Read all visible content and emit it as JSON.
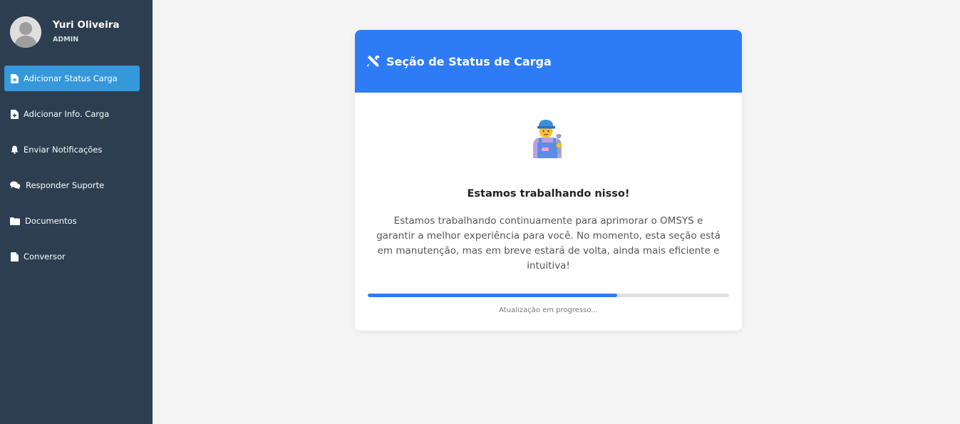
{
  "sidebar": {
    "user": {
      "name": "Yuri Oliveira",
      "role": "ADMIN"
    },
    "items": [
      {
        "label": "Adicionar Status Carga",
        "icon": "file-plus-icon",
        "active": true
      },
      {
        "label": "Adicionar Info. Carga",
        "icon": "file-plus-icon",
        "active": false
      },
      {
        "label": "Enviar Notificações",
        "icon": "bell-icon",
        "active": false
      },
      {
        "label": "Responder Suporte",
        "icon": "comments-icon",
        "active": false
      },
      {
        "label": "Documentos",
        "icon": "folder-icon",
        "active": false
      },
      {
        "label": "Conversor",
        "icon": "file-icon",
        "active": false
      }
    ]
  },
  "card": {
    "title": "Seção de Status de Carga",
    "title_icon": "tools-icon",
    "illustration": "mechanic-emoji",
    "subtitle": "Estamos trabalhando nisso!",
    "description": "Estamos trabalhando continuamente para aprimorar o OMSYS e garantir a melhor experiência para você. No momento, esta seção está em manutenção, mas em breve estará de volta, ainda mais eficiente e intuitiva!",
    "progress_percent": 69,
    "progress_label": "Atualização em progresso..."
  },
  "colors": {
    "sidebar_bg": "#2c3e50",
    "active_item": "#3498db",
    "header_bg": "#2d7cf6",
    "progress_fill": "#2d7cf6",
    "page_bg": "#f5f5f5"
  }
}
